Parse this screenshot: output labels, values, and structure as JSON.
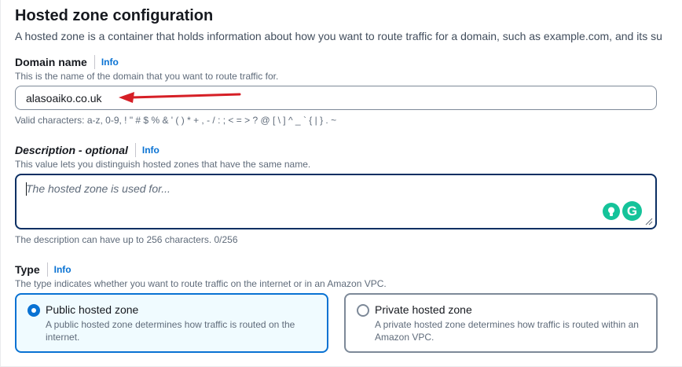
{
  "section": {
    "title": "Hosted zone configuration",
    "description": "A hosted zone is a container that holds information about how you want to route traffic for a domain, such as example.com, and its su"
  },
  "domain_name": {
    "label": "Domain name",
    "info": "Info",
    "description": "This is the name of the domain that you want to route traffic for.",
    "value": "alasoaiko.co.uk",
    "constraint": "Valid characters: a-z, 0-9, ! \" # $ % & ' ( ) * + , - / : ; < = > ? @ [ \\ ] ^ _ ` { | } . ~"
  },
  "description_field": {
    "label": "Description - optional",
    "info": "Info",
    "description": "This value lets you distinguish hosted zones that have the same name.",
    "placeholder": "The hosted zone is used for...",
    "constraint": "The description can have up to 256 characters. 0/256"
  },
  "type": {
    "label": "Type",
    "info": "Info",
    "description": "The type indicates whether you want to route traffic on the internet or in an Amazon VPC.",
    "options": [
      {
        "title": "Public hosted zone",
        "description": "A public hosted zone determines how traffic is routed on the internet.",
        "selected": true
      },
      {
        "title": "Private hosted zone",
        "description": "A private hosted zone determines how traffic is routed within an Amazon VPC.",
        "selected": false
      }
    ]
  },
  "grammarly": {
    "logo_letter": "G",
    "accent_color": "#15c39a"
  },
  "colors": {
    "accent": "#0972d3",
    "annotation_arrow": "#d61f26"
  }
}
